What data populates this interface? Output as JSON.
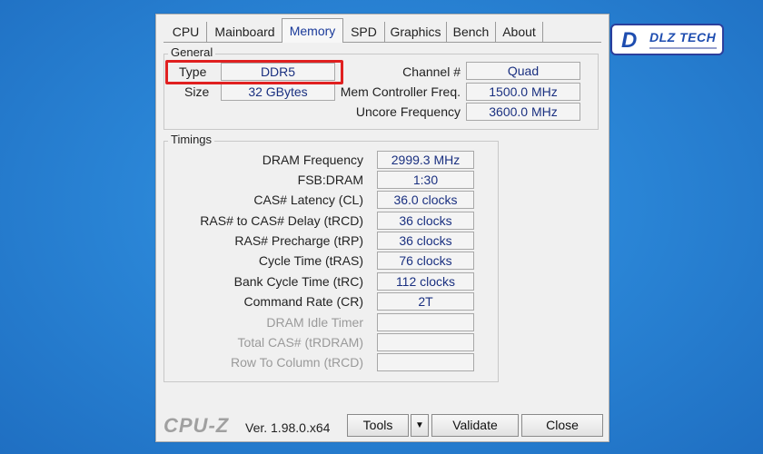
{
  "logo": {
    "mark": "D",
    "text": "DLZ TECH"
  },
  "tabs": [
    {
      "label": "CPU"
    },
    {
      "label": "Mainboard"
    },
    {
      "label": "Memory"
    },
    {
      "label": "SPD"
    },
    {
      "label": "Graphics"
    },
    {
      "label": "Bench"
    },
    {
      "label": "About"
    }
  ],
  "active_tab": "Memory",
  "general": {
    "title": "General",
    "type_label": "Type",
    "type_value": "DDR5",
    "size_label": "Size",
    "size_value": "32 GBytes",
    "channel_label": "Channel #",
    "channel_value": "Quad",
    "mem_ctrl_label": "Mem Controller Freq.",
    "mem_ctrl_value": "1500.0 MHz",
    "uncore_label": "Uncore Frequency",
    "uncore_value": "3600.0 MHz"
  },
  "timings": {
    "title": "Timings",
    "rows": [
      {
        "label": "DRAM Frequency",
        "value": "2999.3 MHz",
        "enabled": true
      },
      {
        "label": "FSB:DRAM",
        "value": "1:30",
        "enabled": true
      },
      {
        "label": "CAS# Latency (CL)",
        "value": "36.0 clocks",
        "enabled": true
      },
      {
        "label": "RAS# to CAS# Delay (tRCD)",
        "value": "36 clocks",
        "enabled": true
      },
      {
        "label": "RAS# Precharge (tRP)",
        "value": "36 clocks",
        "enabled": true
      },
      {
        "label": "Cycle Time (tRAS)",
        "value": "76 clocks",
        "enabled": true
      },
      {
        "label": "Bank Cycle Time (tRC)",
        "value": "112 clocks",
        "enabled": true
      },
      {
        "label": "Command Rate (CR)",
        "value": "2T",
        "enabled": true
      },
      {
        "label": "DRAM Idle Timer",
        "value": "",
        "enabled": false
      },
      {
        "label": "Total CAS# (tRDRAM)",
        "value": "",
        "enabled": false
      },
      {
        "label": "Row To Column (tRCD)",
        "value": "",
        "enabled": false
      }
    ]
  },
  "footer": {
    "brand": "CPU-Z",
    "version": "Ver. 1.98.0.x64",
    "tools_label": "Tools",
    "validate_label": "Validate",
    "close_label": "Close"
  }
}
